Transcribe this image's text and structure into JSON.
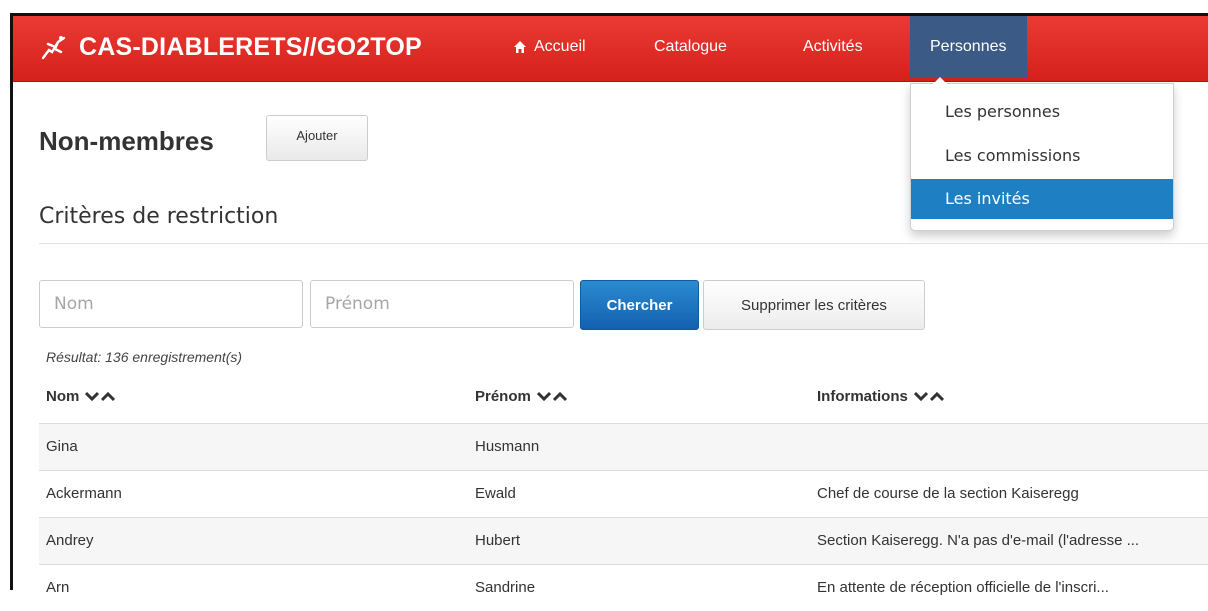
{
  "brand": {
    "name": "CAS-DIABLERETS//GO2TOP"
  },
  "nav": {
    "home": "Accueil",
    "catalogue": "Catalogue",
    "activities": "Activités",
    "persons": "Personnes"
  },
  "dropdown": {
    "items": [
      "Les personnes",
      "Les commissions",
      "Les invités"
    ],
    "selected": "Les invités"
  },
  "page": {
    "title": "Non-membres",
    "add_label": "Ajouter",
    "section": "Critères de restriction"
  },
  "filters": {
    "nom_placeholder": "Nom",
    "prenom_placeholder": "Prénom",
    "search_label": "Chercher",
    "clear_label": "Supprimer les critères"
  },
  "result": "Résultat: 136 enregistrement(s)",
  "table": {
    "columns": [
      "Nom",
      "Prénom",
      "Informations"
    ],
    "rows": [
      {
        "nom": "Gina",
        "prenom": "Husmann",
        "info": ""
      },
      {
        "nom": "Ackermann",
        "prenom": "Ewald",
        "info": "Chef de course de la section Kaiseregg"
      },
      {
        "nom": "Andrey",
        "prenom": "Hubert",
        "info": "Section Kaiseregg. N'a pas d'e-mail (l'adresse ..."
      },
      {
        "nom": "Arn",
        "prenom": "Sandrine",
        "info": "En attente de réception officielle de l'inscri..."
      }
    ]
  },
  "colors": {
    "navbar": "#d9241e",
    "active_nav": "#3c5a86",
    "primary": "#1e7fc2"
  }
}
